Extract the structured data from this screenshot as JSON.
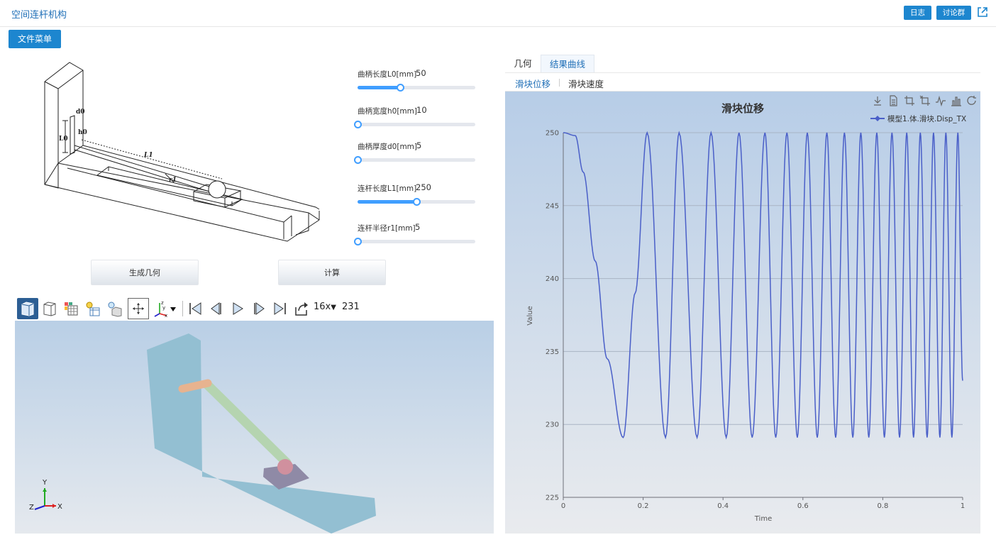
{
  "header": {
    "title": "空间连杆机构",
    "log_label": "日志",
    "discuss_label": "讨论群"
  },
  "file_menu_label": "文件菜单",
  "params": [
    {
      "label": "曲柄长度L0[mm]",
      "value": "50",
      "fraction": 0.36
    },
    {
      "label": "曲柄宽度h0[mm]",
      "value": "10",
      "fraction": 0.0
    },
    {
      "label": "曲柄厚度d0[mm]",
      "value": "5",
      "fraction": 0.0
    },
    {
      "label": "连杆长度L1[mm]",
      "value": "250",
      "fraction": 0.5
    },
    {
      "label": "连杆半径r1[mm]",
      "value": "5",
      "fraction": 0.0
    }
  ],
  "schematic_labels": {
    "d0": "d0",
    "h0": "h0",
    "L0": "L0",
    "L1": "L1",
    "r1": "r1"
  },
  "buttons": {
    "generate": "生成几何",
    "compute": "计算"
  },
  "player": {
    "speed": "16x",
    "frame": "231"
  },
  "axes_triad": {
    "y": "Y",
    "z": "Z",
    "x": "X"
  },
  "toolbar_icons": [
    "solid-view-icon",
    "wireframe-view-icon",
    "mesh-view-icon",
    "light-icon",
    "light-box-icon",
    "fit-view-icon",
    "axis-orientation-icon",
    "first-frame-icon",
    "previous-frame-icon",
    "play-icon",
    "next-frame-icon",
    "last-frame-icon",
    "loop-icon"
  ],
  "tabs": {
    "geometry": "几何",
    "results": "结果曲线"
  },
  "subtabs": {
    "displacement": "滑块位移",
    "velocity": "滑块速度"
  },
  "chart_tool_icons": [
    "download-icon",
    "data-view-icon",
    "zoom-icon",
    "zoom-reset-icon",
    "line-type-icon",
    "bar-type-icon",
    "restore-icon"
  ],
  "colors": {
    "accent": "#1d86cf",
    "series": "#4a5fc8",
    "slider": "#409eff"
  },
  "chart_data": {
    "type": "line",
    "title": "滑块位移",
    "xlabel": "Time",
    "ylabel": "Value",
    "xlim": [
      0,
      1
    ],
    "ylim": [
      225,
      250
    ],
    "xticks": [
      "0",
      "0.2",
      "0.4",
      "0.6",
      "0.8",
      "1"
    ],
    "yticks": [
      "225",
      "230",
      "235",
      "240",
      "245",
      "250"
    ],
    "grid": true,
    "legend": "top-right",
    "series": [
      {
        "name": "模型1.体.滑块.Disp_TX",
        "x": [
          0,
          0.03,
          0.05,
          0.08,
          0.11,
          0.15,
          0.18,
          0.21,
          0.256,
          0.29,
          0.335,
          0.37,
          0.408,
          0.44,
          0.473,
          0.505,
          0.532,
          0.56,
          0.586,
          0.611,
          0.636,
          0.66,
          0.682,
          0.704,
          0.725,
          0.745,
          0.765,
          0.785,
          0.804,
          0.823,
          0.842,
          0.86,
          0.877,
          0.894,
          0.911,
          0.927,
          0.943,
          0.958,
          0.973,
          0.988,
          1.0
        ],
        "y": [
          250,
          249.8,
          247.3,
          241.2,
          234.5,
          229.1,
          239.0,
          250,
          229.1,
          250,
          229.1,
          250,
          229.1,
          250,
          229.1,
          250,
          229.1,
          250,
          229.1,
          250,
          229.1,
          250,
          229.1,
          250,
          229.1,
          250,
          229.1,
          250,
          229.1,
          250,
          229.1,
          250,
          229.1,
          250,
          229.1,
          250,
          229.1,
          250,
          229.1,
          250,
          233.0
        ]
      }
    ]
  }
}
